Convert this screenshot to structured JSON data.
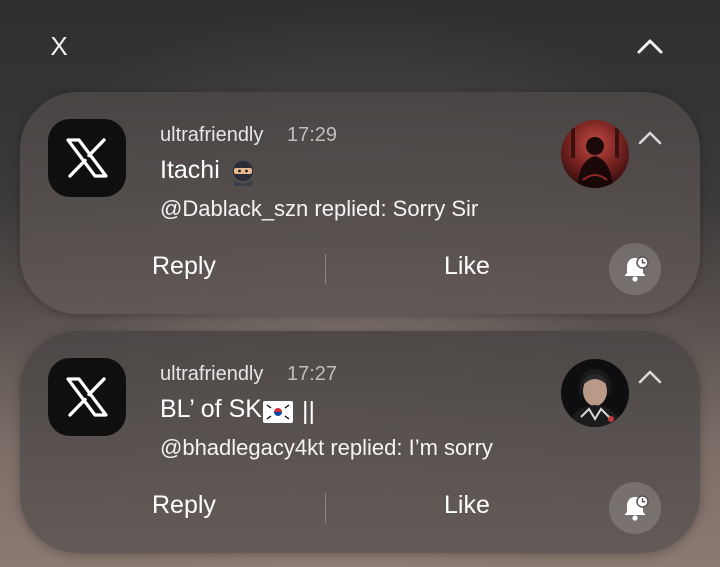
{
  "header": {
    "close_label": "X",
    "collapse_icon": "chevron-up-icon"
  },
  "notifications": [
    {
      "app_icon": "x-logo-icon",
      "sender": "ultrafriendly",
      "time": "17:29",
      "title": "Itachi",
      "title_emoji": "ninja-emoji",
      "body": "@Dablack_szn replied: Sorry Sir",
      "avatar": "avatar-red-figure",
      "actions": {
        "reply": "Reply",
        "like": "Like"
      },
      "snooze_icon": "bell-snooze-icon"
    },
    {
      "app_icon": "x-logo-icon",
      "sender": "ultrafriendly",
      "time": "17:27",
      "title": "BL’ of SK",
      "title_suffix": "||",
      "title_emoji": "south-korea-flag-emoji",
      "body": "@bhadlegacy4kt replied: I’m sorry",
      "avatar": "avatar-man-black-jacket",
      "actions": {
        "reply": "Reply",
        "like": "Like"
      },
      "snooze_icon": "bell-snooze-icon"
    }
  ],
  "colors": {
    "card_bg": "#4d4847",
    "app_icon_bg": "#0f0f10",
    "text_primary": "#ffffff",
    "text_secondary": "#bdbdbd"
  }
}
